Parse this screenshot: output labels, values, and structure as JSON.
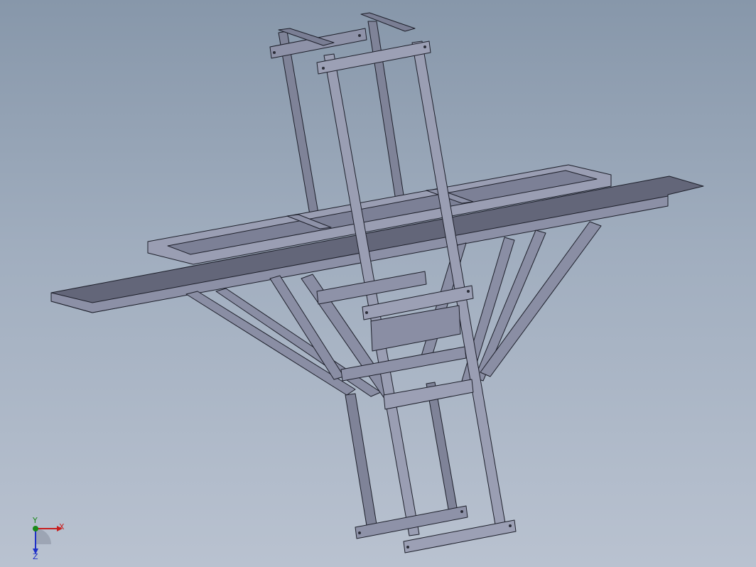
{
  "view": {
    "background_top": "#8797aa",
    "background_bottom": "#b9c2d0"
  },
  "model": {
    "part_color": "#8a8ea4",
    "part_dark": "#55596d",
    "part_light": "#a7abbf",
    "edge_color": "#1d1f2a"
  },
  "triad": {
    "x_label": "X",
    "y_label": "Y",
    "z_label": "Z",
    "x_color": "#c81e1e",
    "y_color": "#1a8a1a",
    "z_color": "#1e2fc8"
  }
}
